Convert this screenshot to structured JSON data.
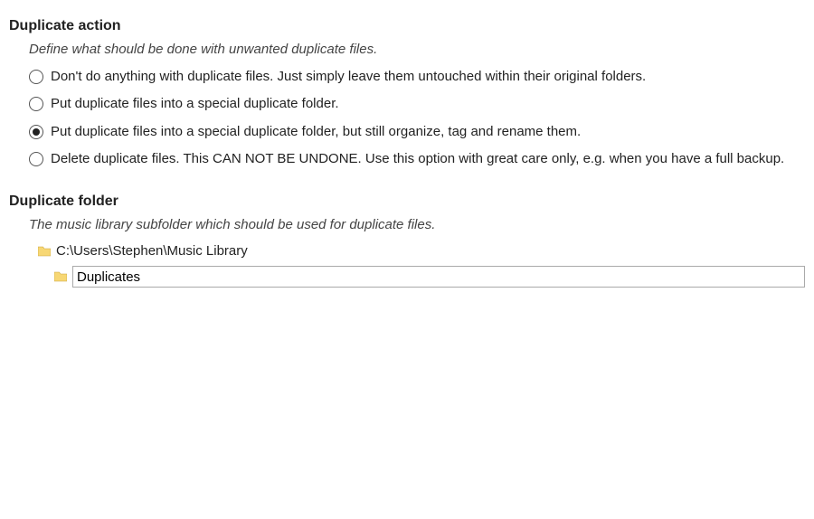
{
  "duplicate_action": {
    "heading": "Duplicate action",
    "subtext": "Define what should be done with unwanted duplicate files.",
    "options": [
      "Don't do anything with duplicate files. Just simply leave them untouched within their original folders.",
      "Put duplicate files into a special duplicate folder.",
      "Put duplicate files into a special duplicate folder, but still organize, tag and rename them.",
      "Delete duplicate files. This CAN NOT BE UNDONE. Use this option with great care only, e.g. when you have a full backup."
    ],
    "selected_index": 2
  },
  "duplicate_folder": {
    "heading": "Duplicate folder",
    "subtext": "The music library subfolder which should be used for duplicate files.",
    "root_path": "C:\\Users\\Stephen\\Music Library",
    "subfolder_value": "Duplicates"
  }
}
